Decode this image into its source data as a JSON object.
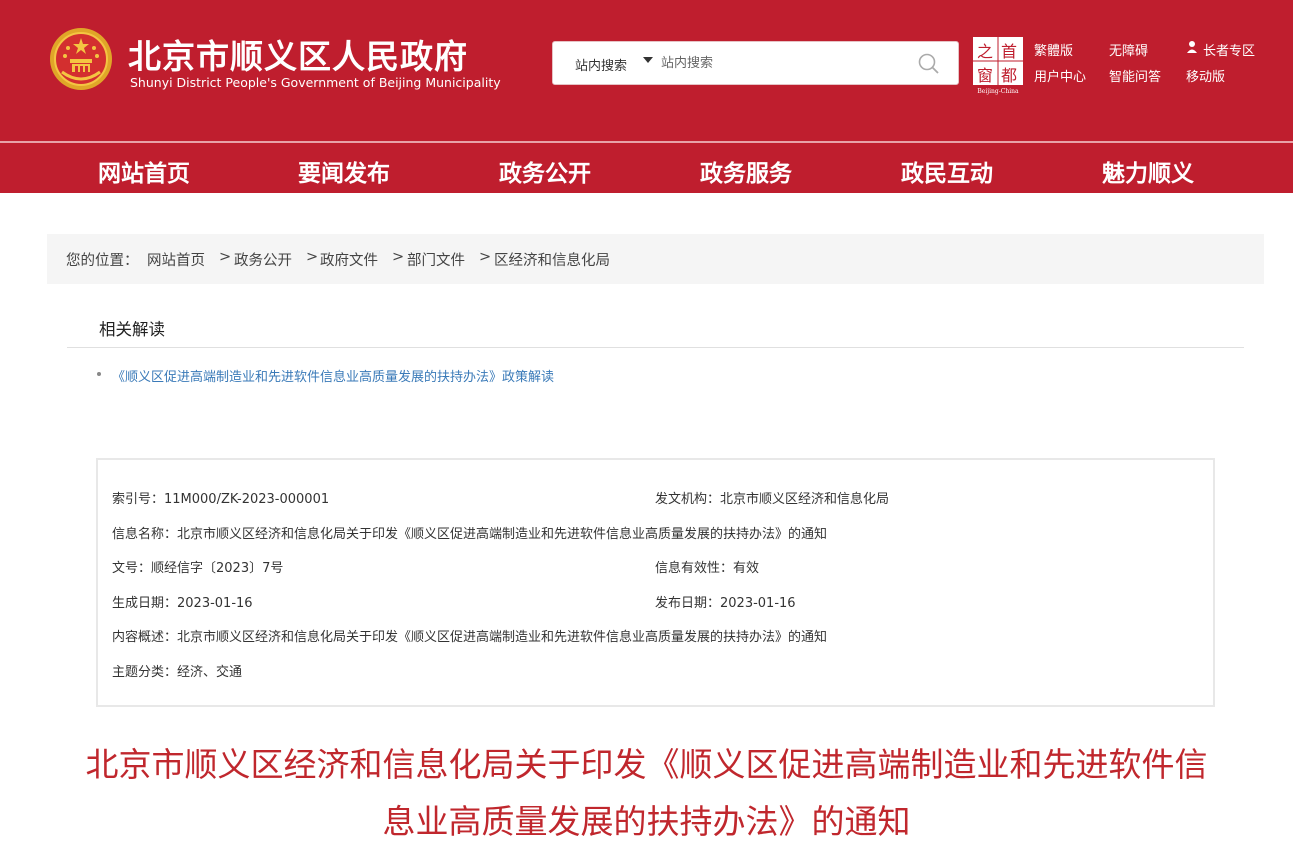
{
  "header": {
    "site_title": "北京市顺义区人民政府",
    "site_subtitle": "Shunyi District People's Government of Beijing Municipality",
    "search": {
      "scope": "站内搜索",
      "placeholder": "站内搜索"
    },
    "capital_logo_text": "首都之窗",
    "capital_logo_sub": "Beijing-China",
    "links": {
      "traditional": "繁體版",
      "accessible": "无障碍",
      "elderly": "长者专区",
      "user_center": "用户中心",
      "smart_qa": "智能问答",
      "mobile": "移动版"
    },
    "colors": {
      "brand": "#bf1e2e",
      "title_red": "#c0272d",
      "link_blue": "#3a7ab8"
    }
  },
  "nav": {
    "items": [
      "网站首页",
      "要闻发布",
      "政务公开",
      "政务服务",
      "政民互动",
      "魅力顺义"
    ]
  },
  "breadcrumb": {
    "prefix": "您的位置：",
    "items": [
      "网站首页",
      "政务公开",
      "政府文件",
      "部门文件",
      "区经济和信息化局"
    ],
    "separator": ">"
  },
  "related": {
    "title": "相关解读",
    "items": [
      "《顺义区促进高端制造业和先进软件信息业高质量发展的扶持办法》政策解读"
    ]
  },
  "meta": {
    "index_no": "索引号：11M000/ZK-2023-000001",
    "issuer": "发文机构：北京市顺义区经济和信息化局",
    "info_name": "信息名称：北京市顺义区经济和信息化局关于印发《顺义区促进高端制造业和先进软件信息业高质量发展的扶持办法》的通知",
    "doc_no": "文号：顺经信字〔2023〕7号",
    "validity": "信息有效性：有效",
    "created": "生成日期：2023-01-16",
    "published": "发布日期：2023-01-16",
    "summary": "内容概述：北京市顺义区经济和信息化局关于印发《顺义区促进高端制造业和先进软件信息业高质量发展的扶持办法》的通知",
    "topic": "主题分类：经济、交通"
  },
  "document": {
    "title_line1": "北京市顺义区经济和信息化局关于印发《顺义区促进高端制造业和先进软件信",
    "title_line2": "息业高质量发展的扶持办法》的通知"
  }
}
